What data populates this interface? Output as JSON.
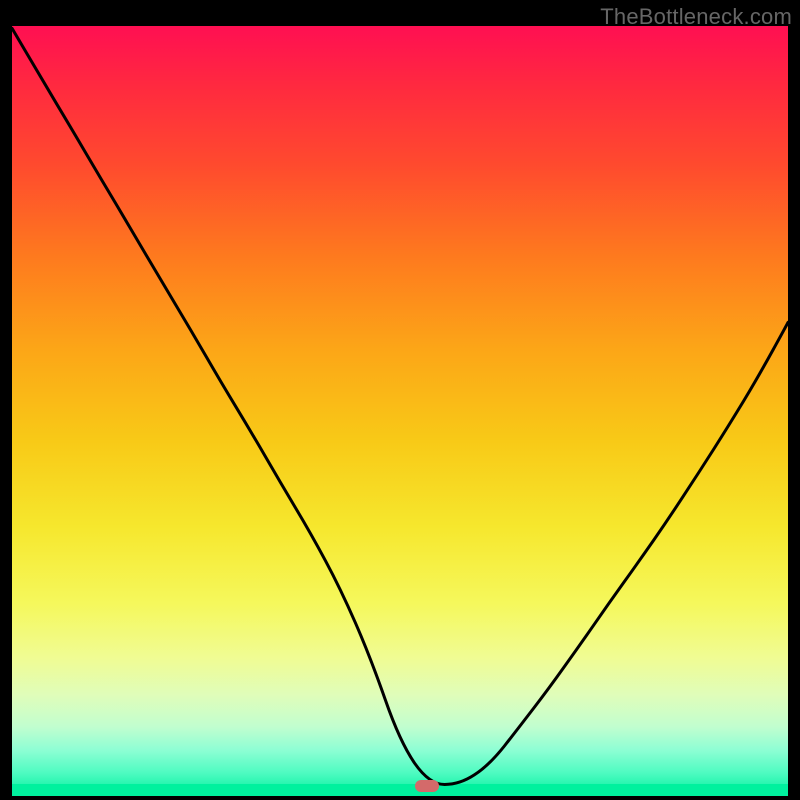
{
  "watermark": "TheBottleneck.com",
  "marker": {
    "x_frac": 0.535,
    "y_frac": 0.987
  },
  "chart_data": {
    "type": "line",
    "title": "",
    "xlabel": "",
    "ylabel": "",
    "xlim": [
      0,
      1
    ],
    "ylim": [
      0,
      1
    ],
    "series": [
      {
        "name": "curve",
        "x": [
          0.0,
          0.038,
          0.077,
          0.115,
          0.154,
          0.192,
          0.231,
          0.269,
          0.308,
          0.346,
          0.385,
          0.423,
          0.462,
          0.5,
          0.538,
          0.577,
          0.615,
          0.654,
          0.692,
          0.731,
          0.769,
          0.808,
          0.846,
          0.885,
          0.923,
          0.962,
          1.0
        ],
        "values": [
          0.997,
          0.932,
          0.866,
          0.801,
          0.735,
          0.67,
          0.604,
          0.538,
          0.473,
          0.407,
          0.341,
          0.27,
          0.18,
          0.07,
          0.015,
          0.015,
          0.04,
          0.09,
          0.14,
          0.195,
          0.25,
          0.305,
          0.36,
          0.42,
          0.48,
          0.545,
          0.615
        ]
      }
    ],
    "notes": "Axes unlabeled; values are fractions of plot width/height. Curve is a V-shaped dip with minimum near x≈0.53 touching the bottom (green) band. Left branch starts near top-left, right branch rises to about 62% height at right edge. Values estimated from pixels."
  }
}
